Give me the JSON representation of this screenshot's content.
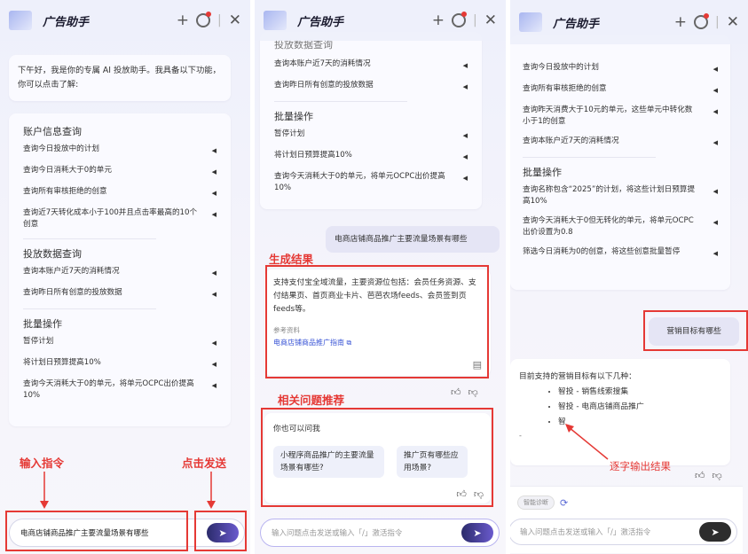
{
  "app": {
    "title": "广告助手"
  },
  "p1": {
    "greeting": "下午好，我是你的专属 AI 投放助手。我具备以下功能，你可以点击了解:",
    "sections": [
      {
        "title": "账户信息查询",
        "items": [
          "查询今日投放中的计划",
          "查询今日消耗大于0的单元",
          "查询所有审核拒绝的创意",
          "查询近7天转化成本小于100并且点击率最高的10个创意"
        ]
      },
      {
        "title": "投放数据查询",
        "items": [
          "查询本账户近7天的消耗情况",
          "查询昨日所有创意的投放数据"
        ]
      },
      {
        "title": "批量操作",
        "items": [
          "暂停计划",
          "将计划日预算提高10%",
          "查询今天消耗大于0的单元，将单元OCPC出价提高10%"
        ]
      }
    ],
    "input_value": "电商店铺商品推广主要流量场景有哪些",
    "ann_input": "输入指令",
    "ann_send": "点击发送"
  },
  "p2": {
    "cut_title": "投放数据查询",
    "items1": [
      "查询本账户近7天的消耗情况",
      "查询昨日所有创意的投放数据"
    ],
    "section2_title": "批量操作",
    "items2": [
      "暂停计划",
      "将计划日预算提高10%",
      "查询今天消耗大于0的单元，将单元OCPC出价提高10%"
    ],
    "user_question": "电商店铺商品推广主要流量场景有哪些",
    "ann_result": "生成结果",
    "answer": "支持支付宝全域流量，主要资源位包括：会员任务资源、支付结果页、首页商业卡片、芭芭农场feeds、会员签到页feeds等。",
    "ref_label": "参考资料",
    "ref_link": "电商店铺商品推广指南",
    "ann_related": "相关问题推荐",
    "ask_label": "你也可以问我",
    "suggest": [
      "小程序商品推广的主要流量场景有哪些?",
      "推广页有哪些应用场景?"
    ],
    "placeholder": "输入问题点击发送或输入「/」激活指令"
  },
  "p3": {
    "cut_item": "查询今日投放中的计划",
    "items1": [
      "查询今日投放中的计划",
      "查询所有审核拒绝的创意",
      "查询昨天消费大于10元的单元，这些单元中转化数小于1的创意",
      "查询本账户近7天的消耗情况"
    ],
    "section2_title": "批量操作",
    "items2": [
      "查询名称包含“2025”的计划，将这些计划日预算提高10%",
      "查询今天消耗大于0但无转化的单元，将单元OCPC出价设置为0.8",
      "筛选今日消耗为0的创意，将这些创意批量暂停"
    ],
    "user_question": "营销目标有哪些",
    "answer_intro": "目前支持的营销目标有以下几种：",
    "answer_items": [
      "智投 - 销售线索搜集",
      "智投 - 电商店铺商品推广",
      "智"
    ],
    "answer_dash": "-",
    "ann_stream": "逐字输出结果",
    "chip": "智能诊断",
    "placeholder": "输入问题点击发送或输入「/」激活指令"
  }
}
